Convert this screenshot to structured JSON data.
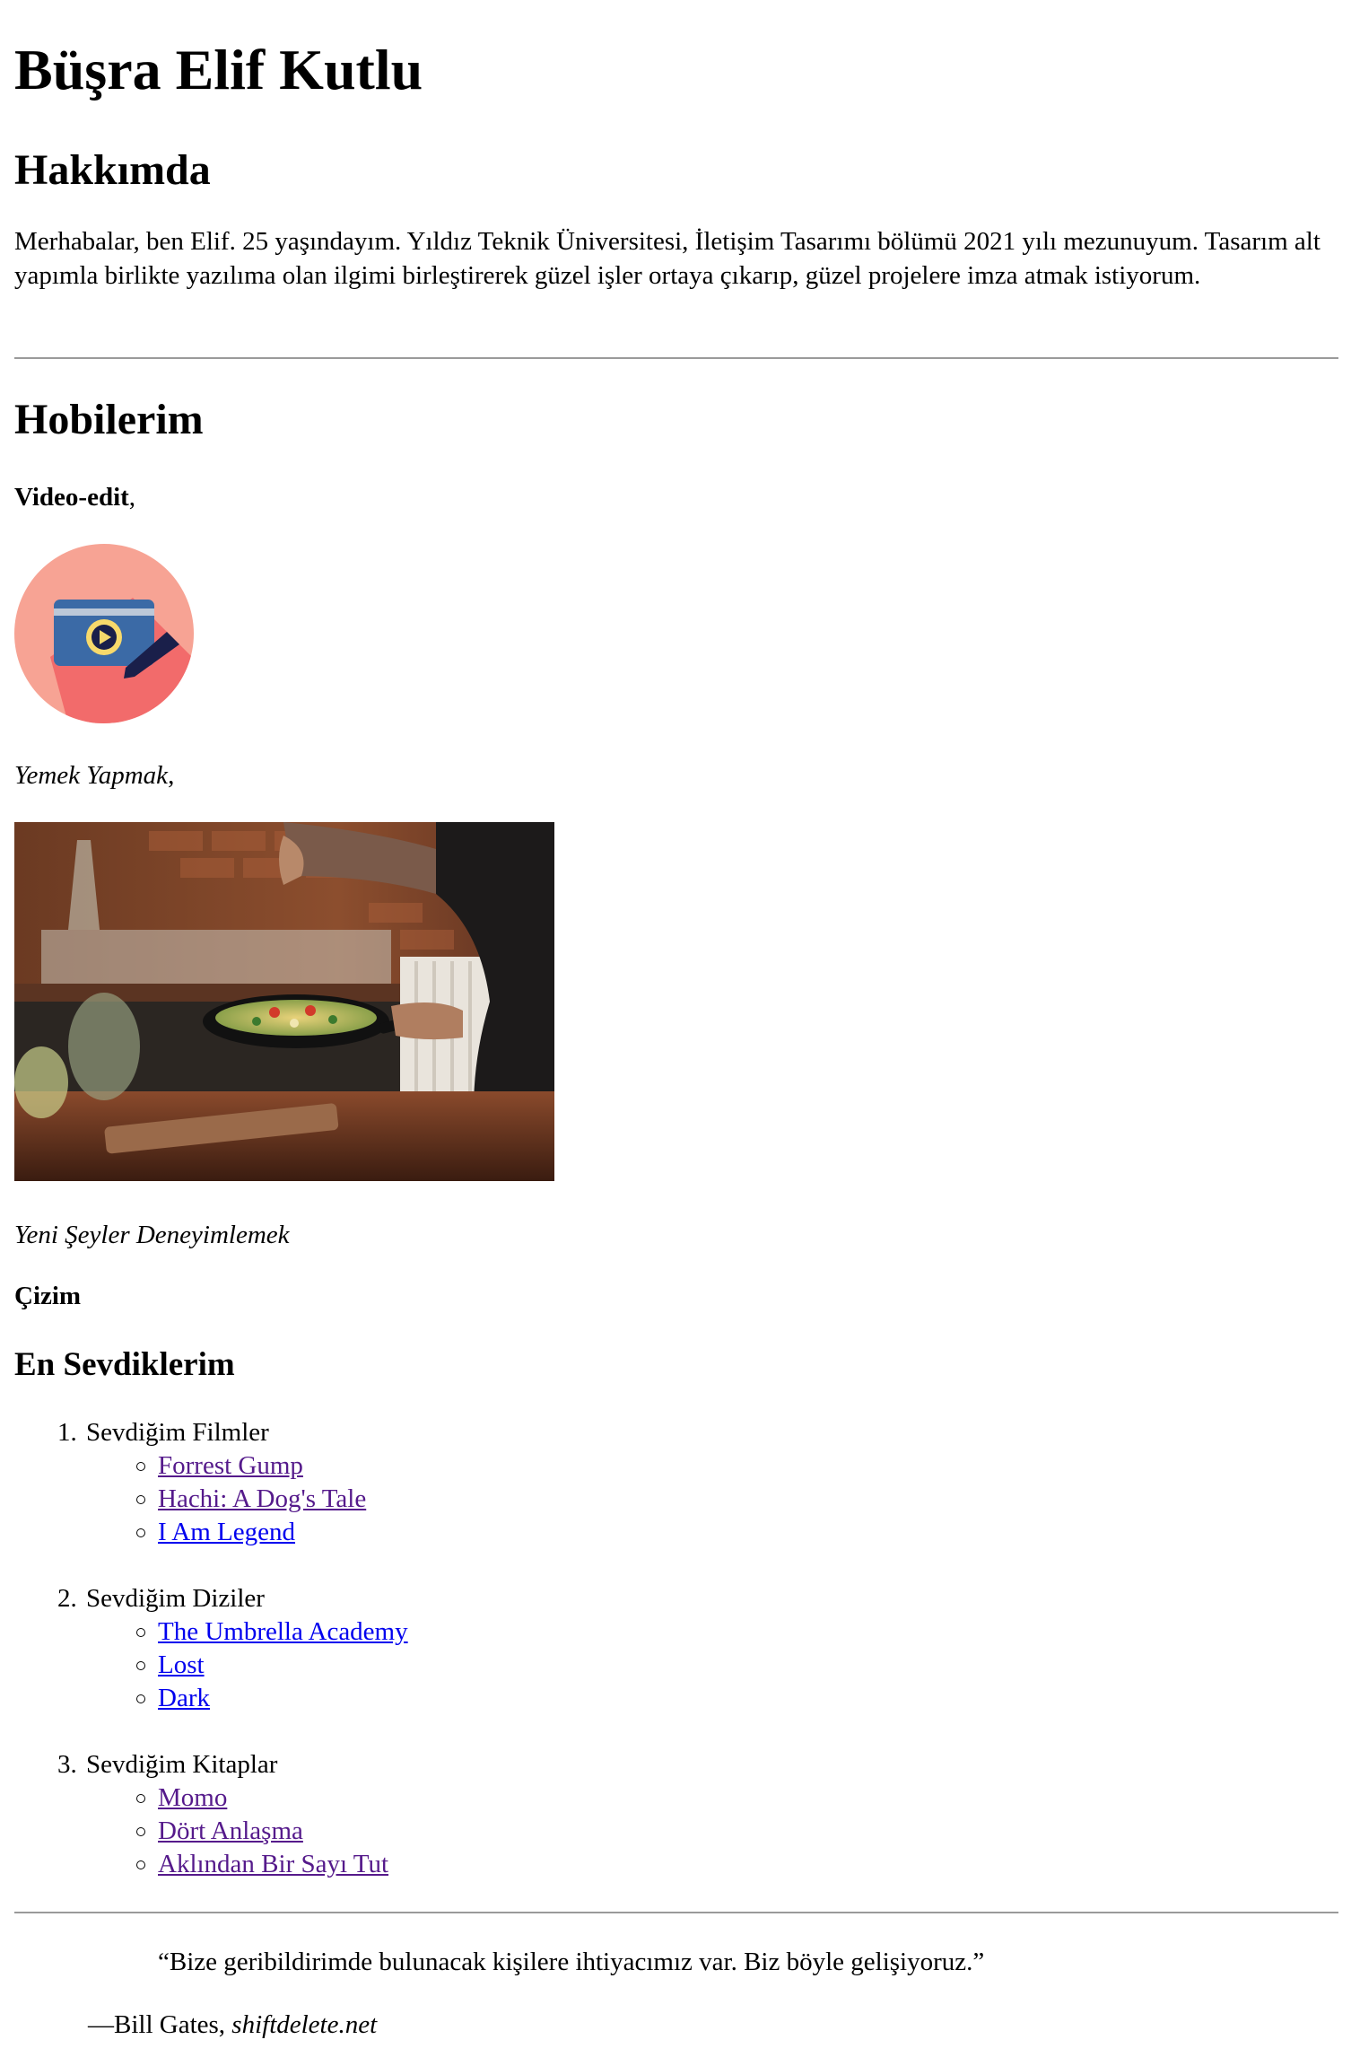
{
  "header": {
    "name": "Büşra Elif Kutlu"
  },
  "about": {
    "heading": "Hakkımda",
    "text": "Merhabalar, ben Elif. 25 yaşındayım. Yıldız Teknik Üniversitesi, İletişim Tasarımı bölümü 2021 yılı mezunuyum. Tasarım alt yapımla birlikte yazılıma olan ilgimi birleştirerek güzel işler ortaya çıkarıp, güzel projelere imza atmak istiyorum."
  },
  "hobbies": {
    "heading": "Hobilerim",
    "video_edit": "Video-edit",
    "video_edit_comma": ",",
    "cooking": "Yemek Yapmak",
    "cooking_comma": ",",
    "new_things": "Yeni Şeyler Deneyimlemek",
    "drawing": "Çizim",
    "icons": {
      "video": "video-edit-icon",
      "cooking": "cooking-photo"
    }
  },
  "favorites": {
    "heading": "En Sevdiklerim",
    "groups": [
      {
        "number": "1.",
        "title": "Sevdiğim Filmler",
        "items": [
          "Forrest Gump",
          "Hachi: A Dog's Tale",
          "I Am Legend"
        ]
      },
      {
        "number": "2.",
        "title": "Sevdiğim Diziler",
        "items": [
          "The Umbrella Academy",
          "Lost",
          "Dark"
        ]
      },
      {
        "number": "3.",
        "title": "Sevdiğim Kitaplar",
        "items": [
          "Momo",
          "Dört Anlaşma",
          "Aklından Bir Sayı Tut"
        ]
      }
    ]
  },
  "quote": {
    "text": "“Bize geribildirimde bulunacak kişilere ihtiyacımız var. Biz böyle gelişiyoruz.”",
    "dash": "—",
    "author": "Bill Gates",
    "separator": ", ",
    "source": "shiftdelete.net"
  },
  "colors": {
    "link": "#0000ee",
    "visited_link": "#551a8b",
    "rule": "#9a9a9a",
    "icon_circle": "#f7a394",
    "icon_shadow": "#f26b6b",
    "icon_card": "#3b6aa6",
    "icon_card_stripe": "#bcc8d8",
    "icon_play": "#f7d96b",
    "icon_pen": "#1a1f4a"
  }
}
